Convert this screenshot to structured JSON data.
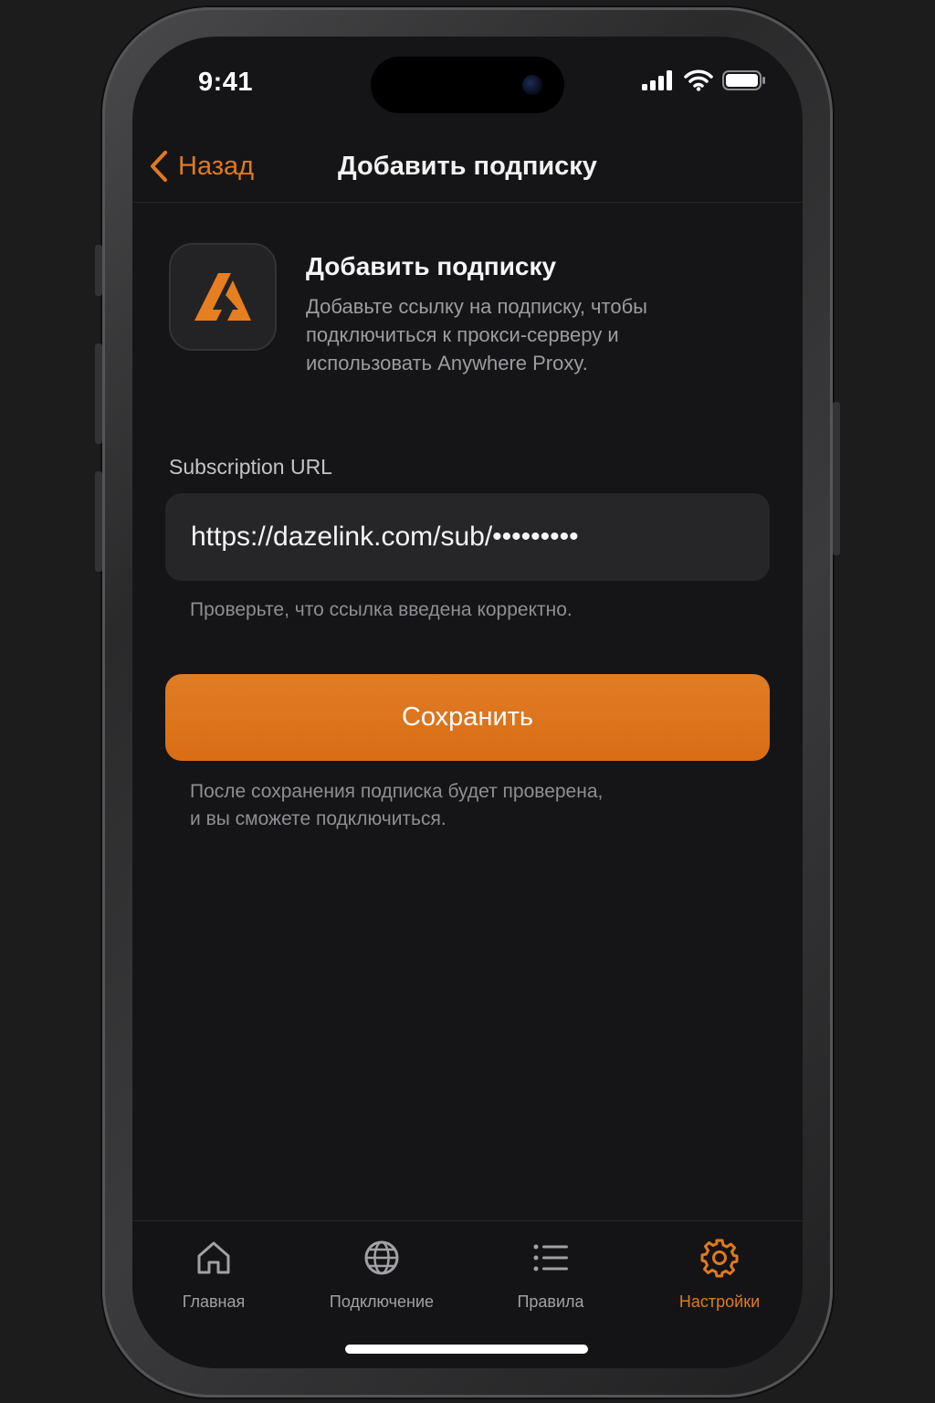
{
  "status": {
    "time": "9:41"
  },
  "nav": {
    "back_label": "Назад",
    "title": "Добавить подписку"
  },
  "header": {
    "title": "Добавить подписку",
    "description": "Добавьте ссылку на подписку, чтобы подключиться к прокси-серверу и использовать Anywhere Proxy."
  },
  "form": {
    "label": "Subscription URL",
    "url_value": "https://dazelink.com/sub/•••••••••",
    "hint": "Проверьте, что ссылка введена корректно.",
    "save_label": "Сохранить",
    "after_note_line1": "После сохранения подписка будет проверена,",
    "after_note_line2": "и вы сможете подключиться."
  },
  "tabs": [
    {
      "label": "Главная",
      "icon": "home-icon"
    },
    {
      "label": "Подключение",
      "icon": "globe-icon"
    },
    {
      "label": "Правила",
      "icon": "list-icon"
    },
    {
      "label": "Настройки",
      "icon": "gear-icon",
      "active": true
    }
  ],
  "colors": {
    "accent": "#e07a1f",
    "background": "#151517",
    "field": "#262628"
  }
}
